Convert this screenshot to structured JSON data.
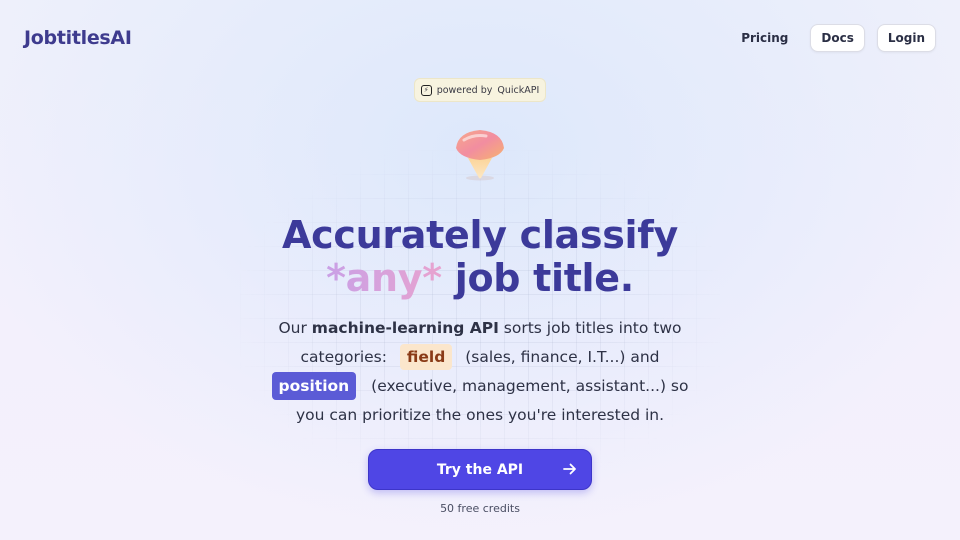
{
  "brand": {
    "logo_text": "JobtitlesAI"
  },
  "nav": {
    "pricing_label": "Pricing",
    "docs_label": "Docs",
    "login_label": "Login"
  },
  "badge": {
    "prefix": "powered by",
    "name": "QuickAPI",
    "icon": "quickapi-logo-icon"
  },
  "hero": {
    "headline_line1": "Accurately classify",
    "headline_any": "*any*",
    "headline_rest": " job title.",
    "desc_intro": "Our ",
    "desc_strong": "machine-learning API",
    "desc_after_strong": " sorts job titles into two categories:",
    "tag_field": "field",
    "desc_field_examples": "(sales, finance, I.T...) and",
    "tag_position": "position",
    "desc_position_examples": "(executive, management, assistant...) so you can prioritize the ones you're interested in."
  },
  "cta": {
    "label": "Try the API",
    "icon": "arrow-right-icon",
    "subtext": "50 free credits"
  },
  "colors": {
    "brand": "#3e3b8e",
    "accent": "#4f46e5",
    "field_tag_bg": "#fbe6cc",
    "position_tag_bg": "#5b5bd6"
  }
}
